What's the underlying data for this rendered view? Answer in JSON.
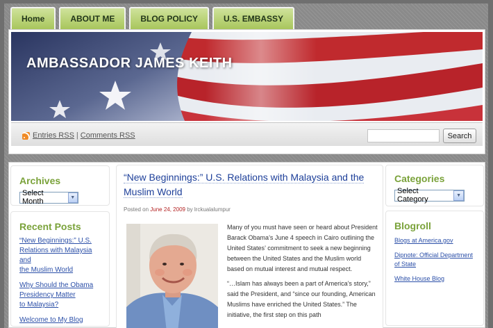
{
  "nav": {
    "tabs": [
      "Home",
      "ABOUT ME",
      "BLOG POLICY",
      "U.S. EMBASSY"
    ]
  },
  "header": {
    "site_title": "AMBASSADOR JAMES KEITH"
  },
  "feeds": {
    "entries": "Entries RSS",
    "separator": "|",
    "comments": "Comments RSS"
  },
  "search": {
    "button": "Search",
    "value": ""
  },
  "archives": {
    "title": "Archives",
    "select": "Select Month"
  },
  "recent_posts": {
    "title": "Recent Posts",
    "items": [
      [
        "“New Beginnings:” U.S.",
        "Relations with Malaysia and",
        "the Muslim World"
      ],
      [
        "Why Should the Obama",
        "Presidency Matter",
        "to Malaysia?"
      ],
      [
        "Welcome to My Blog"
      ]
    ]
  },
  "post": {
    "title_l1": "“New Beginnings:” U.S. Relations with Malaysia and the",
    "title_l2": "Muslim World",
    "posted_on": "Posted on",
    "date": "June 24, 2009",
    "by": "by",
    "author": "lrckualalumpur",
    "para1": "Many of you must have seen or heard about President Barack Obama’s June 4 speech in Cairo outlining the United States’ commitment to seek a new beginning between the United States and the Muslim world based on mutual interest and mutual respect.",
    "para2": "“…Islam has always been a part of America’s story,” said the President, and “since our founding, American Muslims have enriched the United States.” The initiative, the first step on this path"
  },
  "categories": {
    "title": "Categories",
    "select": "Select Category"
  },
  "blogroll": {
    "title": "Blogroll",
    "items": [
      [
        "Blogs at America.gov"
      ],
      [
        "Dipnote: Official Department",
        "of State"
      ],
      [
        "White House Blog"
      ]
    ]
  }
}
